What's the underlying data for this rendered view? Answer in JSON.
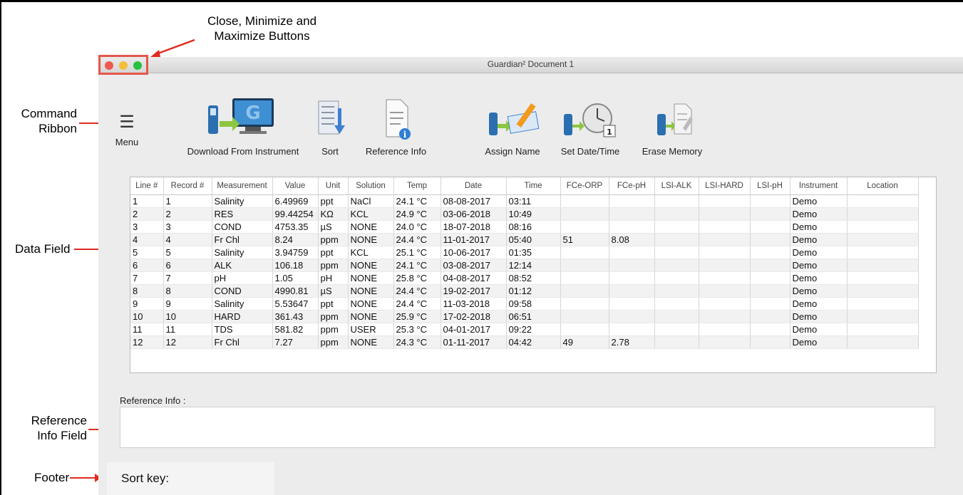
{
  "annotations": {
    "buttons_line1": "Close, Minimize and",
    "buttons_line2": "Maximize Buttons",
    "command_line1": "Command",
    "command_line2": "Ribbon",
    "data_field": "Data Field",
    "ref_line1": "Reference",
    "ref_line2": "Info Field",
    "footer": "Footer"
  },
  "window": {
    "title": "Guardian² Document 1",
    "traffic_colors": [
      "#ee5a52",
      "#f6bd3b",
      "#27c13e"
    ]
  },
  "ribbon": {
    "menu_label": "Menu",
    "buttons": [
      {
        "label": "Download From Instrument",
        "icon": "download-instrument-icon"
      },
      {
        "label": "Sort",
        "icon": "sort-icon"
      },
      {
        "label": "Reference Info",
        "icon": "reference-info-icon"
      },
      {
        "label": "Assign Name",
        "icon": "assign-name-icon"
      },
      {
        "label": "Set Date/Time",
        "icon": "set-date-time-icon"
      },
      {
        "label": "Erase Memory",
        "icon": "erase-memory-icon"
      }
    ]
  },
  "table": {
    "columns": [
      "Line #",
      "Record #",
      "Measurement",
      "Value",
      "Unit",
      "Solution",
      "Temp",
      "Date",
      "Time",
      "FCe-ORP",
      "FCe-pH",
      "LSI-ALK",
      "LSI-HARD",
      "LSI-pH",
      "Instrument",
      "Location"
    ],
    "rows": [
      [
        "1",
        "1",
        "Salinity",
        "6.49969",
        "ppt",
        "NaCl",
        "24.1 °C",
        "08-08-2017",
        "03:11",
        "",
        "",
        "",
        "",
        "",
        "Demo",
        ""
      ],
      [
        "2",
        "2",
        "RES",
        "99.44254",
        "KΩ",
        "KCL",
        "24.9 °C",
        "03-06-2018",
        "10:49",
        "",
        "",
        "",
        "",
        "",
        "Demo",
        ""
      ],
      [
        "3",
        "3",
        "COND",
        "4753.35",
        "µS",
        "NONE",
        "24.0 °C",
        "18-07-2018",
        "08:16",
        "",
        "",
        "",
        "",
        "",
        "Demo",
        ""
      ],
      [
        "4",
        "4",
        "Fr Chl",
        "8.24",
        "ppm",
        "NONE",
        "24.4 °C",
        "11-01-2017",
        "05:40",
        "51",
        "8.08",
        "",
        "",
        "",
        "Demo",
        ""
      ],
      [
        "5",
        "5",
        "Salinity",
        "3.94759",
        "ppt",
        "KCL",
        "25.1 °C",
        "10-06-2017",
        "01:35",
        "",
        "",
        "",
        "",
        "",
        "Demo",
        ""
      ],
      [
        "6",
        "6",
        "ALK",
        "106.18",
        "ppm",
        "NONE",
        "24.1 °C",
        "03-08-2017",
        "12:14",
        "",
        "",
        "",
        "",
        "",
        "Demo",
        ""
      ],
      [
        "7",
        "7",
        "pH",
        "1.05",
        "pH",
        "NONE",
        "25.8 °C",
        "04-08-2017",
        "08:52",
        "",
        "",
        "",
        "",
        "",
        "Demo",
        ""
      ],
      [
        "8",
        "8",
        "COND",
        "4990.81",
        "µS",
        "NONE",
        "24.4 °C",
        "19-02-2017",
        "01:12",
        "",
        "",
        "",
        "",
        "",
        "Demo",
        ""
      ],
      [
        "9",
        "9",
        "Salinity",
        "5.53647",
        "ppt",
        "NONE",
        "24.4 °C",
        "11-03-2018",
        "09:58",
        "",
        "",
        "",
        "",
        "",
        "Demo",
        ""
      ],
      [
        "10",
        "10",
        "HARD",
        "361.43",
        "ppm",
        "NONE",
        "25.9 °C",
        "17-02-2018",
        "06:51",
        "",
        "",
        "",
        "",
        "",
        "Demo",
        ""
      ],
      [
        "11",
        "11",
        "TDS",
        "581.82",
        "ppm",
        "USER",
        "25.3 °C",
        "04-01-2017",
        "09:22",
        "",
        "",
        "",
        "",
        "",
        "Demo",
        ""
      ],
      [
        "12",
        "12",
        "Fr Chl",
        "7.27",
        "ppm",
        "NONE",
        "24.3 °C",
        "01-11-2017",
        "04:42",
        "49",
        "2.78",
        "",
        "",
        "",
        "Demo",
        ""
      ]
    ]
  },
  "reference": {
    "label": "Reference Info :",
    "value": ""
  },
  "footer": {
    "sort_key_label": "Sort key:"
  }
}
